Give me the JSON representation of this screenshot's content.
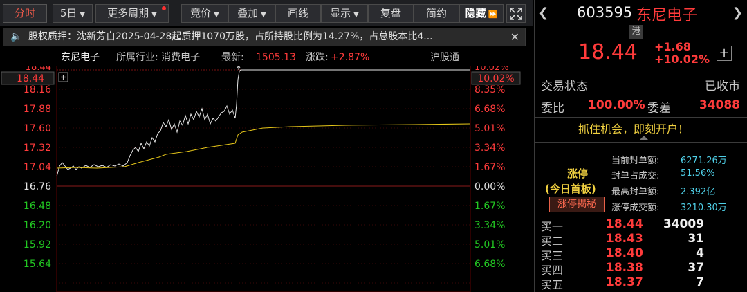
{
  "toolbar": {
    "tabs": [
      {
        "label": "分时",
        "active": true
      },
      {
        "label": "5日",
        "dropdown": true
      },
      {
        "label": "更多周期",
        "dropdown": true,
        "dot": true
      },
      {
        "label": "竞价",
        "dropdown": true
      },
      {
        "label": "叠加",
        "dropdown": true
      },
      {
        "label": "画线"
      },
      {
        "label": "显示",
        "dropdown": true
      },
      {
        "label": "复盘"
      },
      {
        "label": "简约"
      },
      {
        "label": "隐藏",
        "suffix": "⏩"
      }
    ],
    "expand_icon": "expand-icon"
  },
  "notice": {
    "text": "股权质押：沈新芳自2025-04-28起质押1070万股，占所持股比例为14.27%，占总股本比4...",
    "close": "✕"
  },
  "info": {
    "name": "东尼电子",
    "industry": "所属行业: 消费电子",
    "latest_label": "最新:",
    "latest_value": "1505.13",
    "change_label": "涨跌:",
    "change_value": "+2.87%",
    "market": "沪股通"
  },
  "chart": {
    "crosshair_price": "18.44",
    "crosshair_pct": "10.02%",
    "price_top_partial": "18.44",
    "pct_top_partial": "10.02%",
    "y_left": [
      "18.16",
      "17.88",
      "17.60",
      "17.32",
      "17.04",
      "16.76",
      "16.48",
      "16.20",
      "15.92",
      "15.64"
    ],
    "y_right": [
      "8.35%",
      "6.68%",
      "5.01%",
      "3.34%",
      "1.67%",
      "0.00%",
      "1.67%",
      "3.34%",
      "5.01%",
      "6.68%"
    ],
    "colors": {
      "up": "#ff3b3b",
      "down": "#22c722",
      "flat": "#e0e0e0",
      "avg": "#e6c619",
      "price": "#e8e8e8"
    }
  },
  "stock": {
    "code": "603595",
    "name": "东尼电子",
    "tag": "港",
    "price": "18.44",
    "change": "+1.68",
    "change_pct": "+10.02%",
    "status_label": "交易状态",
    "status_value": "已收市",
    "wb_label": "委比",
    "wb_value": "100.00%",
    "wc_label": "委差",
    "wc_value": "34088",
    "promo": "抓住机会，即刻开户！",
    "limit_title": "涨停",
    "limit_sub": "(今日首板)",
    "limit_btn": "涨停揭秘",
    "limit_stats": [
      {
        "label": "当前封单额:",
        "value": "6271.26万"
      },
      {
        "label": "封单占成交:",
        "value": "51.56%"
      },
      {
        "label": "最高封单额:",
        "value": "2.392亿"
      },
      {
        "label": "涨停成交额:",
        "value": "3210.30万"
      }
    ],
    "bids": [
      {
        "label": "买一",
        "price": "18.44",
        "vol": "34009"
      },
      {
        "label": "买二",
        "price": "18.43",
        "vol": "31"
      },
      {
        "label": "买三",
        "price": "18.40",
        "vol": "4"
      },
      {
        "label": "买四",
        "price": "18.38",
        "vol": "37"
      },
      {
        "label": "买五",
        "price": "18.37",
        "vol": "7"
      }
    ]
  }
}
